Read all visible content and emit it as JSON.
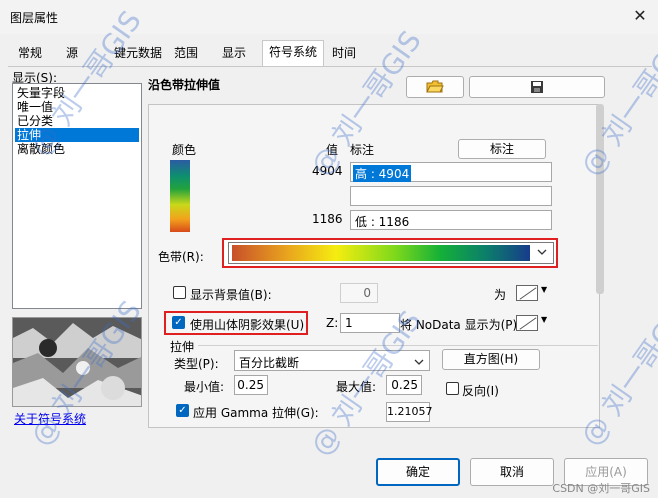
{
  "window": {
    "title": "图层属性",
    "close_glyph": "✕"
  },
  "tabs": [
    {
      "label": "常规"
    },
    {
      "label": "源"
    },
    {
      "label": "键元数据"
    },
    {
      "label": "范围"
    },
    {
      "label": "显示"
    },
    {
      "label": "符号系统",
      "active": true
    },
    {
      "label": "时间"
    }
  ],
  "sidebar": {
    "show_label": "显示(S):",
    "items": [
      {
        "label": "矢量字段"
      },
      {
        "label": "唯一值"
      },
      {
        "label": "已分类"
      },
      {
        "label": "拉伸",
        "selected": true
      },
      {
        "label": "离散颜色"
      }
    ],
    "link": "关于符号系统"
  },
  "symbology": {
    "section_title": "沿色带拉伸值",
    "open_icon": "folder-open-icon",
    "save_icon": "save-icon",
    "color_header": "颜色",
    "value_header": "值",
    "label_header": "标注",
    "label_button": "标注",
    "high_value": "4904",
    "high_label": "高 : 4904",
    "low_value": "1186",
    "low_label": "低 : 1186",
    "color_band_label": "色带(R):",
    "background": {
      "label": "显示背景值(B):",
      "value": "0",
      "as_label": "为",
      "checked": false
    },
    "hillshade": {
      "label": "使用山体阴影效果(U)",
      "checked": true,
      "z_label": "Z:",
      "z_value": "1"
    },
    "nodata_label": "将 NoData 显示为(P)",
    "stretch": {
      "group_label": "拉伸",
      "type_label": "类型(P):",
      "type_value": "百分比截断",
      "histogram_button": "直方图(H)",
      "min_label": "最小值:",
      "min_value": "0.25",
      "max_label": "最大值:",
      "max_value": "0.25",
      "invert_label": "反向(I)",
      "gamma_label": "应用 Gamma 拉伸(G):",
      "gamma_value": "1.21057",
      "gamma_checked": true
    }
  },
  "footer": {
    "ok": "确定",
    "cancel": "取消",
    "apply": "应用(A)"
  },
  "watermark": {
    "text": "@ 刘一哥GIS",
    "credit": "CSDN @刘一哥GIS"
  }
}
